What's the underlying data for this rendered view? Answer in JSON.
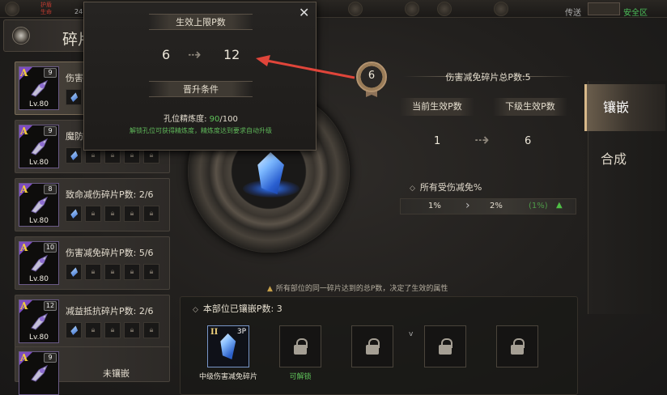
{
  "topbar": {
    "status_mini": "护盾\n生命",
    "level_num": "24",
    "transfer_label": "传送",
    "safe_zone_label": "安全区"
  },
  "header": {
    "title": "碎片"
  },
  "list": {
    "items": [
      {
        "grade": "A",
        "count": "9",
        "level": "Lv.80",
        "name": "伤害...",
        "slots": [
          "gem",
          "lock",
          "lock",
          "lock",
          "lock"
        ],
        "active": true
      },
      {
        "grade": "A",
        "count": "9",
        "level": "Lv.80",
        "name": "魔防...",
        "slots": [
          "gem",
          "lock",
          "lock",
          "lock",
          "lock"
        ]
      },
      {
        "grade": "A",
        "count": "8",
        "level": "Lv.80",
        "name": "致命减伤碎片P数: 2/6",
        "slots": [
          "gem",
          "lock",
          "lock",
          "lock",
          "lock"
        ]
      },
      {
        "grade": "A",
        "count": "10",
        "level": "Lv.80",
        "name": "伤害减免碎片P数: 5/6",
        "slots": [
          "gem",
          "lock",
          "lock",
          "lock",
          "lock"
        ]
      },
      {
        "grade": "A",
        "count": "12",
        "level": "Lv.80",
        "name": "减益抵抗碎片P数: 2/6",
        "slots": [
          "gem",
          "lock",
          "lock",
          "lock",
          "lock"
        ]
      },
      {
        "grade": "A",
        "count": "9",
        "level": "",
        "name": "未镶嵌",
        "slots": [],
        "unset": true
      }
    ]
  },
  "popup": {
    "title_upper_limit": "生效上限P数",
    "from": "6",
    "to": "12",
    "title_promote": "晋升条件",
    "progress_label": "孔位精炼度: ",
    "progress_current": "90",
    "progress_max": "/100",
    "hint": "解锁孔位可获得精炼度，精炼度达到要求自动升级",
    "close_icon": "close-icon"
  },
  "medal": {
    "value": "6"
  },
  "right": {
    "total_label": "伤害减免碎片总P数:5",
    "current_label": "当前生效P数",
    "next_label": "下级生效P数",
    "current_value": "1",
    "next_value": "6",
    "attr_title": "所有受伤减免%",
    "attr_from": "1%",
    "attr_to": "2%",
    "attr_delta": "(1%)"
  },
  "tabs": [
    {
      "label": "镶嵌",
      "active": true
    },
    {
      "label": "合成",
      "active": false
    }
  ],
  "bottom": {
    "note": "所有部位的同一碎片达到的总P数，决定了生效的属性",
    "inlaid_label": "本部位已镶嵌P数: 3",
    "slot1_roman": "II",
    "slot1_p": "3P",
    "slot1_caption": "中级伤害减免碎片",
    "slot2_caption": "可解锁",
    "v_mark": "v"
  },
  "colors": {
    "accent_gold": "#d8b98a",
    "green_text": "#5fc35a",
    "pointer_red": "#e0453a",
    "crystal_blue": "#3a8cff"
  }
}
